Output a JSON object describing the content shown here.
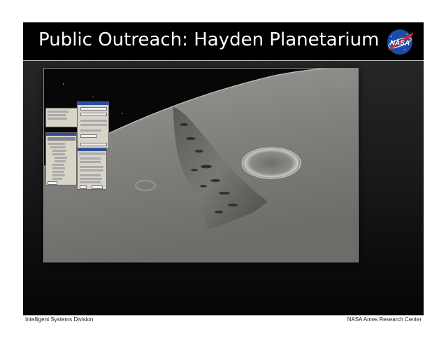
{
  "slide": {
    "title": "Public Outreach:  Hayden Planetarium",
    "logo": "NASA",
    "footer_left": "Intelligent Systems Division",
    "footer_right": "NASA Ames Research Center"
  },
  "colors": {
    "background": "#000000",
    "title_text": "#ffffff",
    "logo_blue": "#1c4ba6",
    "logo_red": "#d8262f"
  }
}
